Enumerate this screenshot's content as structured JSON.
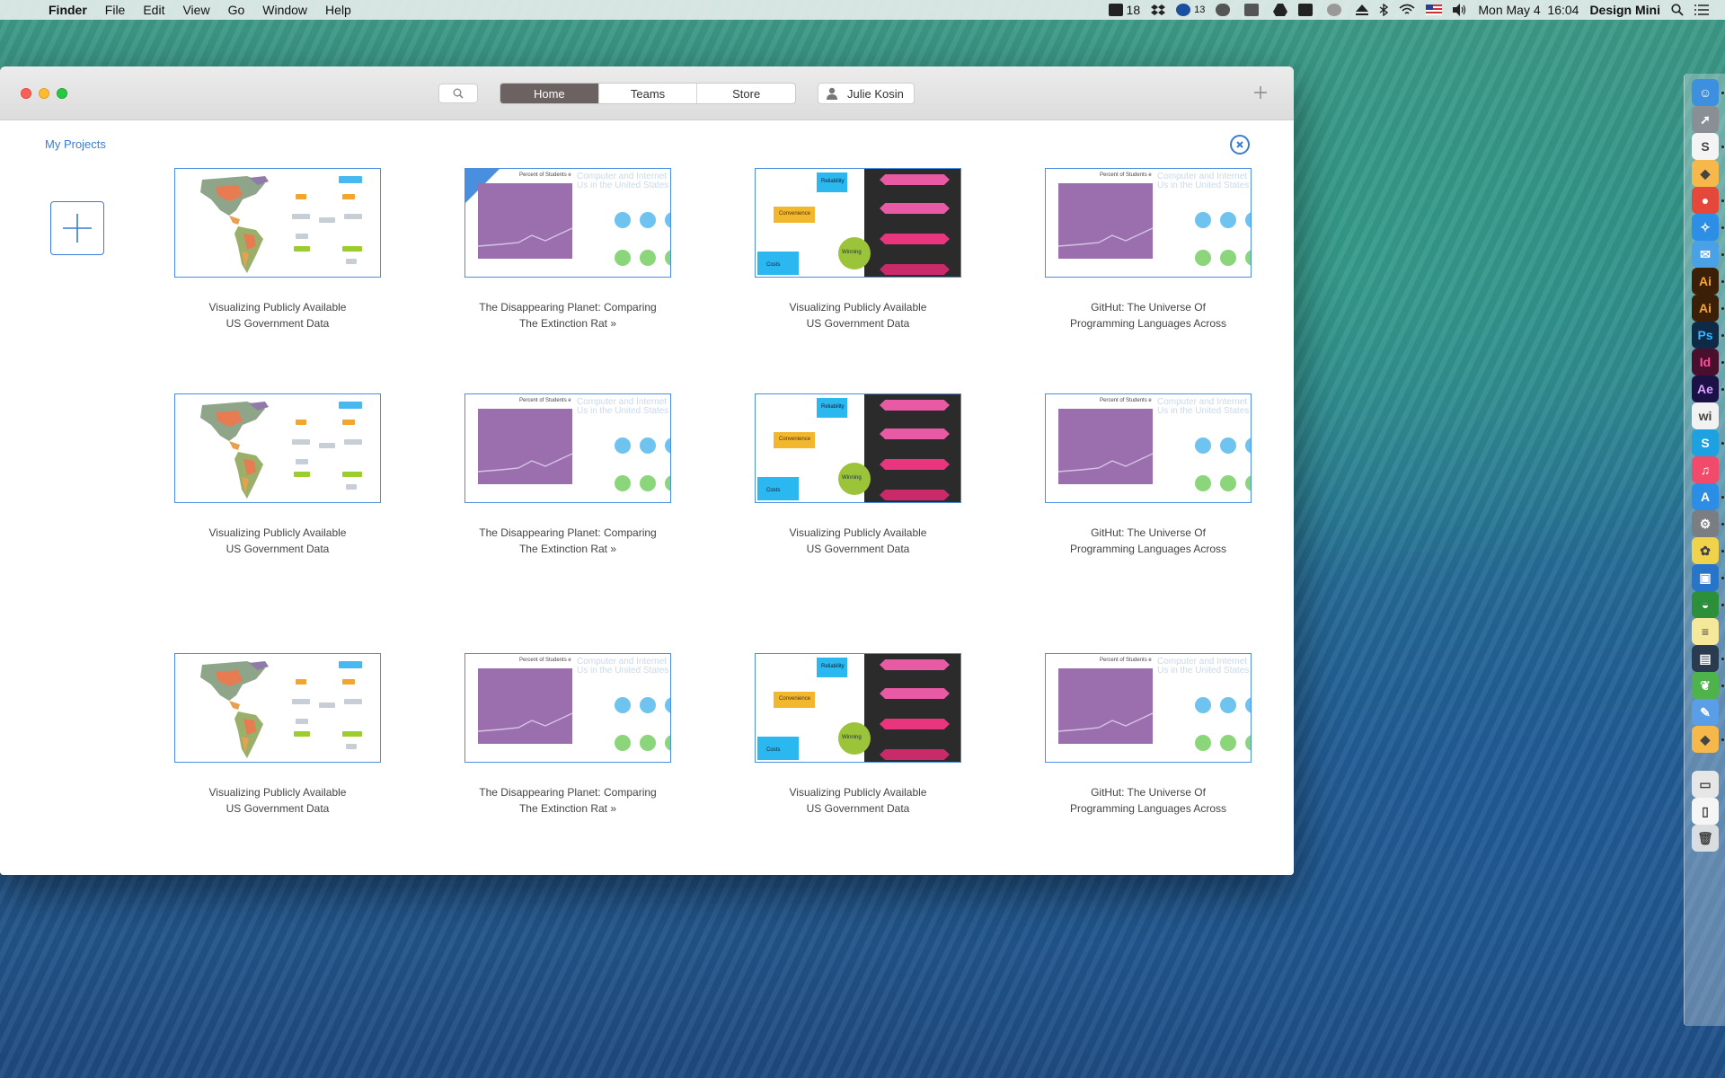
{
  "menubar": {
    "app": "Finder",
    "menus": [
      "File",
      "Edit",
      "View",
      "Go",
      "Window",
      "Help"
    ],
    "status": {
      "adobe_count": "18",
      "creative_cloud_count": "13",
      "datetime": "Mon May 4  16:04",
      "user": "Design Mini"
    }
  },
  "window": {
    "tabs": [
      "Home",
      "Teams",
      "Store"
    ],
    "active_tab": "Home",
    "user_label": "Julie Kosin",
    "section_title": "My Projects"
  },
  "projects": [
    {
      "line1": "Visualizing Publicly Available",
      "line2": "US Government Data",
      "thumb": "map"
    },
    {
      "line1": "The Disappearing Planet: Comparing",
      "line2": "The Extinction Rat »",
      "thumb": "chart"
    },
    {
      "line1": "Visualizing Publicly Available",
      "line2": "US Government Data",
      "thumb": "dark"
    },
    {
      "line1": "GitHut: The Universe Of",
      "line2": "Programming Languages Across",
      "thumb": "chart"
    },
    {
      "line1": "Visualizing Publicly Available",
      "line2": "US Government Data",
      "thumb": "map"
    },
    {
      "line1": "The Disappearing Planet: Comparing",
      "line2": "The Extinction Rat »",
      "thumb": "chart"
    },
    {
      "line1": "Visualizing Publicly Available",
      "line2": "US Government Data",
      "thumb": "dark"
    },
    {
      "line1": "GitHut: The Universe Of",
      "line2": "Programming Languages Across",
      "thumb": "chart"
    },
    {
      "line1": "Visualizing Publicly Available",
      "line2": "US Government Data",
      "thumb": "map"
    },
    {
      "line1": "The Disappearing Planet: Comparing",
      "line2": "The Extinction Rat »",
      "thumb": "chart"
    },
    {
      "line1": "Visualizing Publicly Available",
      "line2": "US Government Data",
      "thumb": "dark"
    },
    {
      "line1": "GitHut: The Universe Of",
      "line2": "Programming Languages Across",
      "thumb": "chart"
    }
  ],
  "thumb_text": {
    "chart_title": "Percent of Students e",
    "chart_heading": "Computer and Internet Us in the United States",
    "dark_label_1": "Reliability",
    "dark_label_2": "Convenience",
    "dark_label_3": "Costs",
    "dark_label_4": "Winning"
  },
  "dock": [
    {
      "name": "finder-icon",
      "color": "#3d8fe0",
      "glyph": "☺"
    },
    {
      "name": "launchpad-icon",
      "color": "#8a8f96",
      "glyph": "➚"
    },
    {
      "name": "slack-icon",
      "color": "#f4f4f4",
      "glyph": "S"
    },
    {
      "name": "sketch-icon",
      "color": "#f6b84b",
      "glyph": "◆"
    },
    {
      "name": "chrome-icon",
      "color": "#e5483b",
      "glyph": "●"
    },
    {
      "name": "safari-icon",
      "color": "#2d8ee5",
      "glyph": "✧"
    },
    {
      "name": "mail-icon",
      "color": "#4aa1e6",
      "glyph": "✉"
    },
    {
      "name": "illustrator-icon",
      "color": "#3b1f07",
      "glyph": "Ai"
    },
    {
      "name": "illustrator-2-icon",
      "color": "#3b1f07",
      "glyph": "Ai"
    },
    {
      "name": "photoshop-icon",
      "color": "#0e2a47",
      "glyph": "Ps"
    },
    {
      "name": "indesign-icon",
      "color": "#4a0f2c",
      "glyph": "Id"
    },
    {
      "name": "after-effects-icon",
      "color": "#1b1147",
      "glyph": "Ae"
    },
    {
      "name": "wiki-icon",
      "color": "#f2f2f2",
      "glyph": "wi"
    },
    {
      "name": "skype-icon",
      "color": "#1da1e0",
      "glyph": "S"
    },
    {
      "name": "itunes-icon",
      "color": "#f24a6a",
      "glyph": "♫"
    },
    {
      "name": "app-store-icon",
      "color": "#2b8de6",
      "glyph": "A"
    },
    {
      "name": "system-preferences-icon",
      "color": "#7a7d82",
      "glyph": "⚙"
    },
    {
      "name": "photos-icon",
      "color": "#f0d34a",
      "glyph": "✿"
    },
    {
      "name": "screen-app-icon",
      "color": "#2774c9",
      "glyph": "▣"
    },
    {
      "name": "helmet-app-icon",
      "color": "#2c8f3a",
      "glyph": "◒"
    },
    {
      "name": "notes-icon",
      "color": "#f6e89a",
      "glyph": "≡"
    },
    {
      "name": "window-app-icon",
      "color": "#2a3b4f",
      "glyph": "▤"
    },
    {
      "name": "leaf-app-icon",
      "color": "#4db34a",
      "glyph": "❦"
    },
    {
      "name": "pencil-app-icon",
      "color": "#5a9ee8",
      "glyph": "✎"
    },
    {
      "name": "sketch-2-icon",
      "color": "#f6b84b",
      "glyph": "◆"
    },
    {
      "name": "scanner-icon",
      "color": "#e6e6e6",
      "glyph": "▭"
    },
    {
      "name": "documents-icon",
      "color": "#f5f5f5",
      "glyph": "▯"
    },
    {
      "name": "trash-icon",
      "color": "#d9dde0",
      "glyph": "🗑"
    }
  ]
}
